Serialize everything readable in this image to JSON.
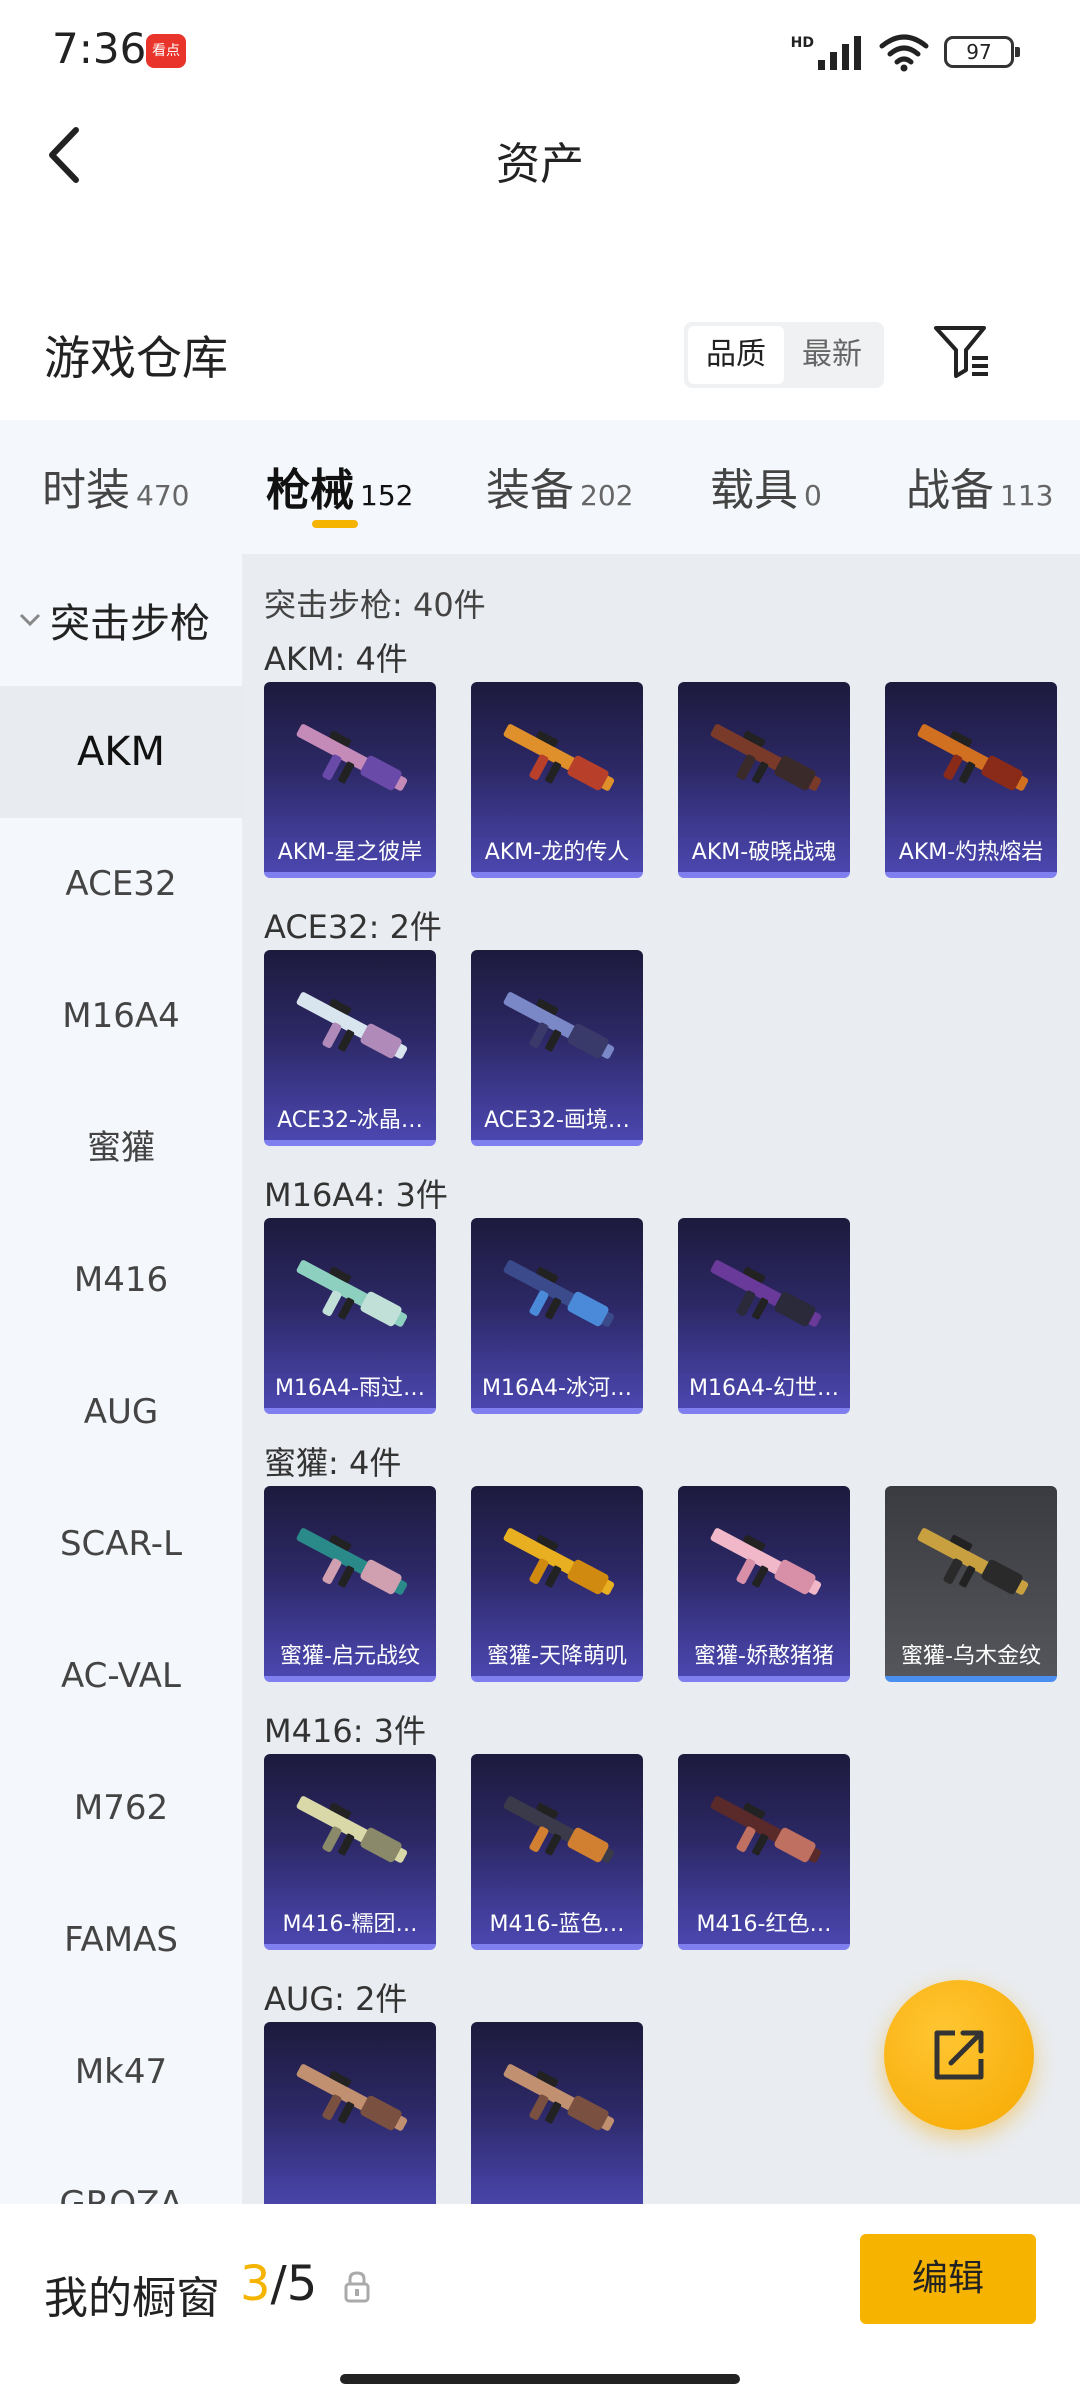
{
  "status_bar": {
    "time": "7:36",
    "app_badge": "看点",
    "network_label": "HD",
    "battery": "97"
  },
  "header": {
    "title": "资产",
    "back_icon": "back-chevron-icon"
  },
  "warehouse": {
    "title": "游戏仓库",
    "sort_options": [
      "品质",
      "最新"
    ],
    "selected_sort": "品质",
    "filter_icon": "filter-icon"
  },
  "tabs": [
    {
      "label": "时装",
      "count": "470"
    },
    {
      "label": "枪械",
      "count": "152"
    },
    {
      "label": "装备",
      "count": "202"
    },
    {
      "label": "载具",
      "count": "0"
    },
    {
      "label": "战备",
      "count": "113"
    }
  ],
  "active_tab": "枪械",
  "sidebar": {
    "category": "突击步枪",
    "items": [
      "AKM",
      "ACE32",
      "M16A4",
      "蜜獾",
      "M416",
      "AUG",
      "SCAR-L",
      "AC-VAL",
      "M762",
      "FAMAS",
      "Mk47",
      "GROZA"
    ],
    "active_item": "AKM"
  },
  "content": {
    "total": "突击步枪: 40件",
    "groups": [
      {
        "label": "AKM: 4件",
        "items": [
          "AKM-星之彼岸",
          "AKM-龙的传人",
          "AKM-破晓战魂",
          "AKM-灼热熔岩"
        ]
      },
      {
        "label": "ACE32: 2件",
        "items": [
          "ACE32-冰晶…",
          "ACE32-画境…"
        ]
      },
      {
        "label": "M16A4: 3件",
        "items": [
          "M16A4-雨过…",
          "M16A4-冰河…",
          "M16A4-幻世…"
        ]
      },
      {
        "label": "蜜獾: 4件",
        "items": [
          "蜜獾-启元战纹",
          "蜜獾-天降萌叽",
          "蜜獾-娇憨猪猪",
          "蜜獾-乌木金纹"
        ]
      },
      {
        "label": "M416: 3件",
        "items": [
          "M416-糯团…",
          "M416-蓝色…",
          "M416-红色…"
        ]
      },
      {
        "label": "AUG: 2件",
        "items": [
          "",
          ""
        ]
      }
    ]
  },
  "fab": {
    "icon": "share-external-icon"
  },
  "bottom_bar": {
    "title": "我的橱窗",
    "current": "3",
    "slash": "/",
    "max": "5",
    "lock_icon": "lock-icon",
    "edit_label": "编辑"
  },
  "colors": {
    "accent": "#f6b400",
    "card_top": "#1d1a3d",
    "card_bottom": "#4b47b0",
    "card_border": "#7f7ff0"
  }
}
